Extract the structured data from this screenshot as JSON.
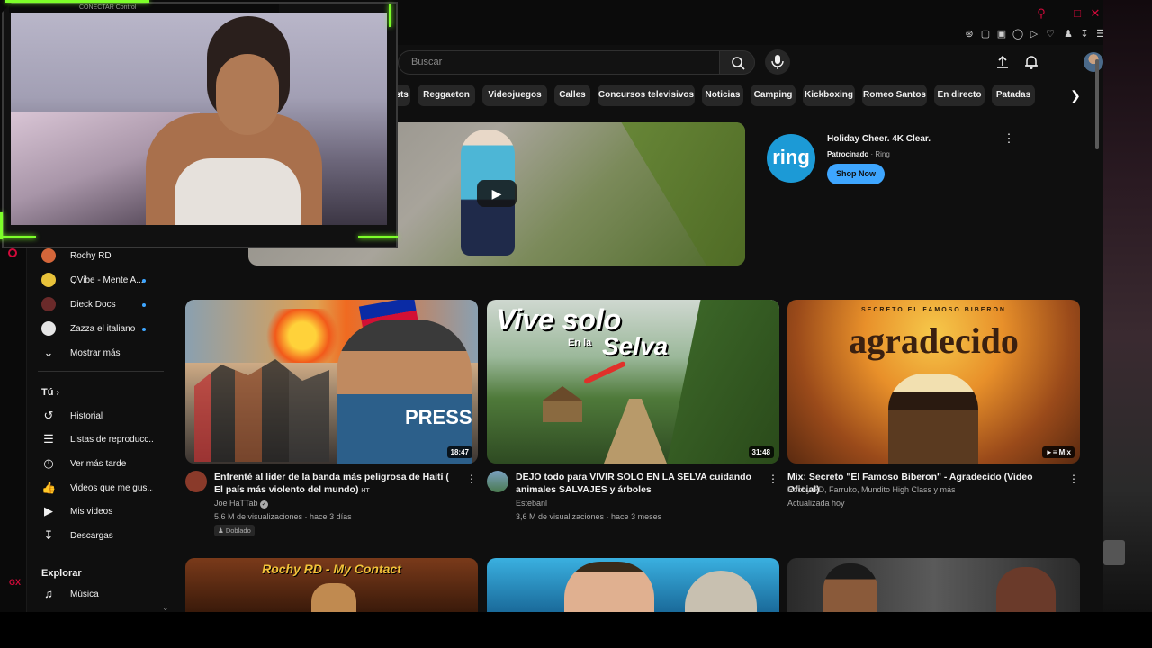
{
  "browser": {
    "tab_title": "CONECTAR Control"
  },
  "header": {
    "search_placeholder": "Buscar"
  },
  "chips": [
    "dcasts",
    "Reggaeton",
    "Videojuegos",
    "Calles",
    "Concursos televisivos",
    "Noticias",
    "Camping",
    "Kickboxing",
    "Romeo Santos",
    "En directo",
    "Patadas"
  ],
  "ad": {
    "logo_text": "ring",
    "title": "Holiday Cheer. 4K Clear.",
    "sponsored": "Patrocinado",
    "advertiser": "Ring",
    "cta": "Shop Now"
  },
  "sidebar": {
    "subscriptions": [
      {
        "label": "Rochy RD",
        "color": "#d4663a",
        "dot": false
      },
      {
        "label": "QVibe - Mente A...",
        "color": "#e8c23a",
        "dot": true
      },
      {
        "label": "Dieck Docs",
        "color": "#6a2a2a",
        "dot": true
      },
      {
        "label": "Zazza el italiano",
        "color": "#e6e6e6",
        "dot": true
      }
    ],
    "show_more": "Mostrar más",
    "you_heading": "Tú",
    "you_items": [
      "Historial",
      "Listas de reproducc...",
      "Ver más tarde",
      "Videos que me gus...",
      "Mis videos",
      "Descargas"
    ],
    "explore_heading": "Explorar",
    "explore_items": [
      "Música"
    ]
  },
  "videos": [
    {
      "title": "Enfrenté al líder de la banda más peligrosa de Haití ( El país más violento del mundo)",
      "title_suffix": "HT",
      "channel": "Joe HaTTab",
      "verified": true,
      "stats": "5,6 M de visualizaciones · hace 3 días",
      "badge": "Doblado",
      "duration": "18:47",
      "thumb_text": "PRESS"
    },
    {
      "title": "DEJO todo para VIVIR SOLO EN LA SELVA cuidando animales SALVAJES y árboles",
      "channel": "Estebanl",
      "verified": false,
      "stats": "3,6 M de visualizaciones · hace 3 meses",
      "duration": "31:48",
      "thumb_text_1": "Vive solo",
      "thumb_text_2": "En la",
      "thumb_text_3": "Selva"
    },
    {
      "title": "Mix: Secreto \"El Famoso Biberon\" - Agradecido (Video Oficial)",
      "channel": "Rochy RD, Farruko, Mundito High Class y más",
      "stats": "Actualizada hoy",
      "duration": "Mix",
      "thumb_top": "SECRETO EL FAMOSO BIBERON",
      "thumb_text": "agradecido"
    }
  ],
  "row2": {
    "thumb1_text": "Rochy RD - My Contact"
  },
  "colors": {
    "accent_green": "#7dff2a",
    "browser_red": "#d10a3a",
    "link_blue": "#3ea6ff",
    "background": "#0f0f0f"
  }
}
